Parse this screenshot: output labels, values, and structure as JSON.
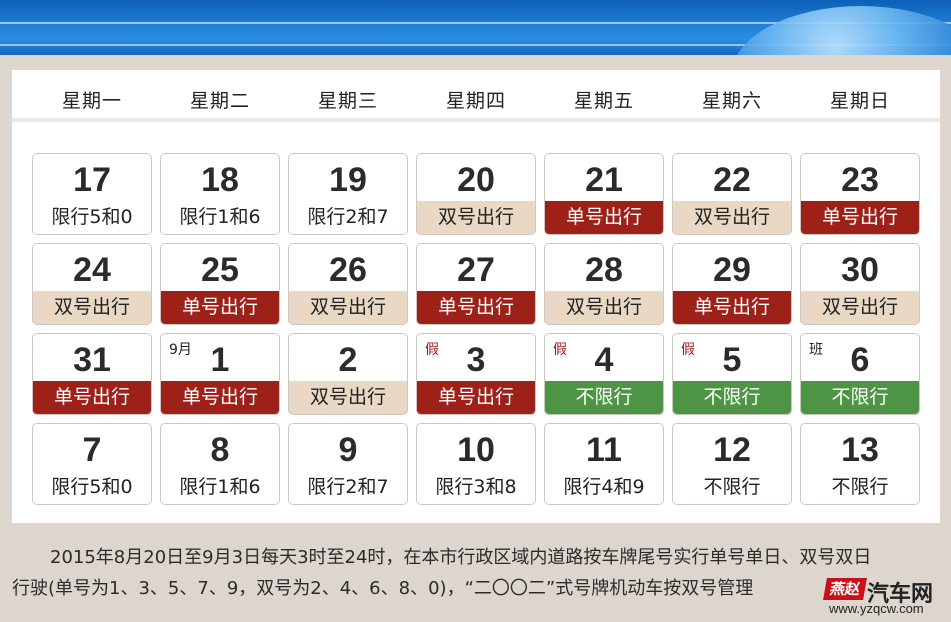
{
  "weekdays": [
    "星期一",
    "星期二",
    "星期三",
    "星期四",
    "星期五",
    "星期六",
    "星期日"
  ],
  "calendar": {
    "rows": [
      [
        {
          "day": "17",
          "rule": "限行5和0",
          "kind": "plain",
          "tag": ""
        },
        {
          "day": "18",
          "rule": "限行1和6",
          "kind": "plain",
          "tag": ""
        },
        {
          "day": "19",
          "rule": "限行2和7",
          "kind": "plain",
          "tag": ""
        },
        {
          "day": "20",
          "rule": "双号出行",
          "kind": "even",
          "tag": ""
        },
        {
          "day": "21",
          "rule": "单号出行",
          "kind": "odd",
          "tag": ""
        },
        {
          "day": "22",
          "rule": "双号出行",
          "kind": "even",
          "tag": ""
        },
        {
          "day": "23",
          "rule": "单号出行",
          "kind": "odd",
          "tag": ""
        }
      ],
      [
        {
          "day": "24",
          "rule": "双号出行",
          "kind": "even",
          "tag": ""
        },
        {
          "day": "25",
          "rule": "单号出行",
          "kind": "odd",
          "tag": ""
        },
        {
          "day": "26",
          "rule": "双号出行",
          "kind": "even",
          "tag": ""
        },
        {
          "day": "27",
          "rule": "单号出行",
          "kind": "odd",
          "tag": ""
        },
        {
          "day": "28",
          "rule": "双号出行",
          "kind": "even",
          "tag": ""
        },
        {
          "day": "29",
          "rule": "单号出行",
          "kind": "odd",
          "tag": ""
        },
        {
          "day": "30",
          "rule": "双号出行",
          "kind": "even",
          "tag": ""
        }
      ],
      [
        {
          "day": "31",
          "rule": "单号出行",
          "kind": "odd",
          "tag": ""
        },
        {
          "day": "1",
          "rule": "单号出行",
          "kind": "odd",
          "tag": "9月"
        },
        {
          "day": "2",
          "rule": "双号出行",
          "kind": "even",
          "tag": ""
        },
        {
          "day": "3",
          "rule": "单号出行",
          "kind": "odd",
          "tag": "假"
        },
        {
          "day": "4",
          "rule": "不限行",
          "kind": "free",
          "tag": "假"
        },
        {
          "day": "5",
          "rule": "不限行",
          "kind": "free",
          "tag": "假"
        },
        {
          "day": "6",
          "rule": "不限行",
          "kind": "free",
          "tag": "班"
        }
      ],
      [
        {
          "day": "7",
          "rule": "限行5和0",
          "kind": "plain",
          "tag": ""
        },
        {
          "day": "8",
          "rule": "限行1和6",
          "kind": "plain",
          "tag": ""
        },
        {
          "day": "9",
          "rule": "限行2和7",
          "kind": "plain",
          "tag": ""
        },
        {
          "day": "10",
          "rule": "限行3和8",
          "kind": "plain",
          "tag": ""
        },
        {
          "day": "11",
          "rule": "限行4和9",
          "kind": "plain",
          "tag": ""
        },
        {
          "day": "12",
          "rule": "不限行",
          "kind": "plain",
          "tag": ""
        },
        {
          "day": "13",
          "rule": "不限行",
          "kind": "plain",
          "tag": ""
        }
      ]
    ]
  },
  "note": {
    "line1": "2015年8月20日至9月3日每天3时至24时，在本市行政区域内道路按车牌尾号实行单号单日、双号双日",
    "line2": "行驶(单号为1、3、5、7、9，双号为2、4、6、8、0)，“二〇〇二”式号牌机动车按双号管理"
  },
  "watermark": {
    "logo_left": "燕赵",
    "logo_right": "汽车网",
    "url": "www.yzqcw.com"
  },
  "colors": {
    "odd": "#9d2019",
    "even": "#e8d8c4",
    "free": "#4d9444",
    "banner": "#1f7fd6"
  }
}
